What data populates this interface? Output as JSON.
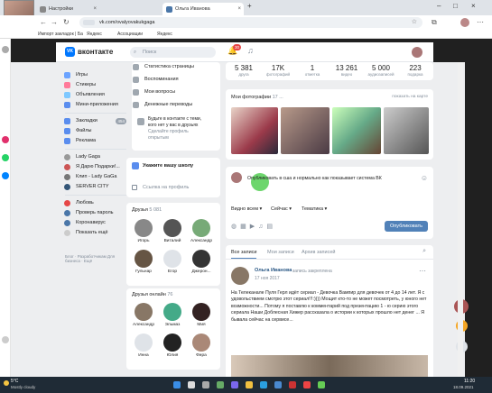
{
  "browser": {
    "tabs": [
      {
        "label": "Настройки"
      },
      {
        "label": "Ольга Иванова"
      }
    ],
    "url": "vk.com/ovalyovakukgaga",
    "bookmarks": [
      "Импорт закладок | Ба...",
      "Яндекс",
      "Ассоциации",
      "Яндекс"
    ]
  },
  "vk": {
    "logo": "вконтакте",
    "search_placeholder": "Поиск",
    "notif_count": "30",
    "nav": [
      {
        "label": "Статистика страницы",
        "color": "#a0a8b0"
      },
      {
        "label": "Воспоминания",
        "color": "#a0a8b0"
      },
      {
        "label": "Мои вопросы",
        "color": "#a0a8b0"
      },
      {
        "label": "Денежные переводы",
        "color": "#a0a8b0"
      }
    ],
    "left_items": [
      {
        "label": "Игры",
        "color": "#6ba3ff"
      },
      {
        "label": "Стикеры",
        "color": "#ff7a9a"
      },
      {
        "label": "Объявления",
        "color": "#7ec8ff"
      },
      {
        "label": "Мини-приложения",
        "color": "#5a8dee"
      }
    ],
    "left_items2": [
      {
        "label": "Закладки",
        "color": "#5a8dee",
        "badge": "454"
      },
      {
        "label": "Файлы",
        "color": "#5a8dee"
      },
      {
        "label": "Реклама",
        "color": "#5a8dee"
      }
    ],
    "left_groups": [
      {
        "label": "Lady Gaga"
      },
      {
        "label": "Я Дарю Подарки!..."
      },
      {
        "label": "Клип - Lady GaGa"
      },
      {
        "label": "SERVER CITY"
      }
    ],
    "left_groups2": [
      {
        "label": "Любовь"
      },
      {
        "label": "Проверь пароль"
      },
      {
        "label": "Коронавирус"
      },
      {
        "label": "Показать ещё"
      }
    ],
    "footer_links": "Блог · Разработчикам Для бизнеса · Ещё",
    "promo": {
      "line1": "Будьте в контакте с теми,",
      "line2": "кого нет у вас в друзьях",
      "line3": "Сделайте профиль",
      "line4": "открытым"
    },
    "school": {
      "title": "Укажите вашу школу",
      "link": "Ссылка на профиль"
    },
    "friends": {
      "title": "Друзья",
      "count": "5 081",
      "items": [
        {
          "name": "Игорь"
        },
        {
          "name": "Виталий"
        },
        {
          "name": "Александр"
        }
      ],
      "items2": [
        {
          "name": "Гульнар"
        },
        {
          "name": "Егор"
        },
        {
          "name": "Джерон..."
        }
      ]
    },
    "online": {
      "title": "Друзья онлайн",
      "count": "76",
      "items": [
        {
          "name": "Александр"
        },
        {
          "name": "Эльмаз"
        },
        {
          "name": "Мия"
        }
      ],
      "items2": [
        {
          "name": "Инна"
        },
        {
          "name": "Юлия"
        },
        {
          "name": "Фира"
        }
      ]
    },
    "stats": [
      {
        "value": "5 381",
        "label": "друга"
      },
      {
        "value": "17K",
        "label": "фотографий"
      },
      {
        "value": "1",
        "label": "отметка"
      },
      {
        "value": "13 261",
        "label": "видео"
      },
      {
        "value": "5 000",
        "label": "аудиозаписей"
      },
      {
        "value": "223",
        "label": "подарка"
      }
    ],
    "photos": {
      "title": "Мои фотографии",
      "count": "17 ...",
      "link": "показать на карте"
    },
    "composer": {
      "text": "Опубликовать в сша и нормально как показывает система ВК",
      "opt1": "Видно всем",
      "opt2": "Сейчас",
      "opt3": "Тематика",
      "publish": "Опубликовать"
    },
    "wall": {
      "tab1": "Все записи",
      "tab2": "Мои записи",
      "tab3": "Архив записей"
    },
    "post": {
      "author": "Ольга Иванова",
      "action": "запись закреплена",
      "date": "17 ноя 2017",
      "text": "На Телеканале Пуля Герл идёт сериал - Девочка Вампир для девочек от 4 до 14 лет. Я с удовольствием смотрю этот сериал!!!:)))) Мощит кто-то не может посмотреть, у юного нет возможности... Потому я поставлю к комментарий под презентацию 1 - ю серию этого сериала Наши Доблесная Хижер рассказала о истории к которых прошло нет денег ... Я бывала сейчас на сервисе..."
    }
  },
  "taskbar": {
    "temp": "5°C",
    "weather": "Mostly cloudy",
    "time": "11:20",
    "date": "18.09.2021"
  }
}
